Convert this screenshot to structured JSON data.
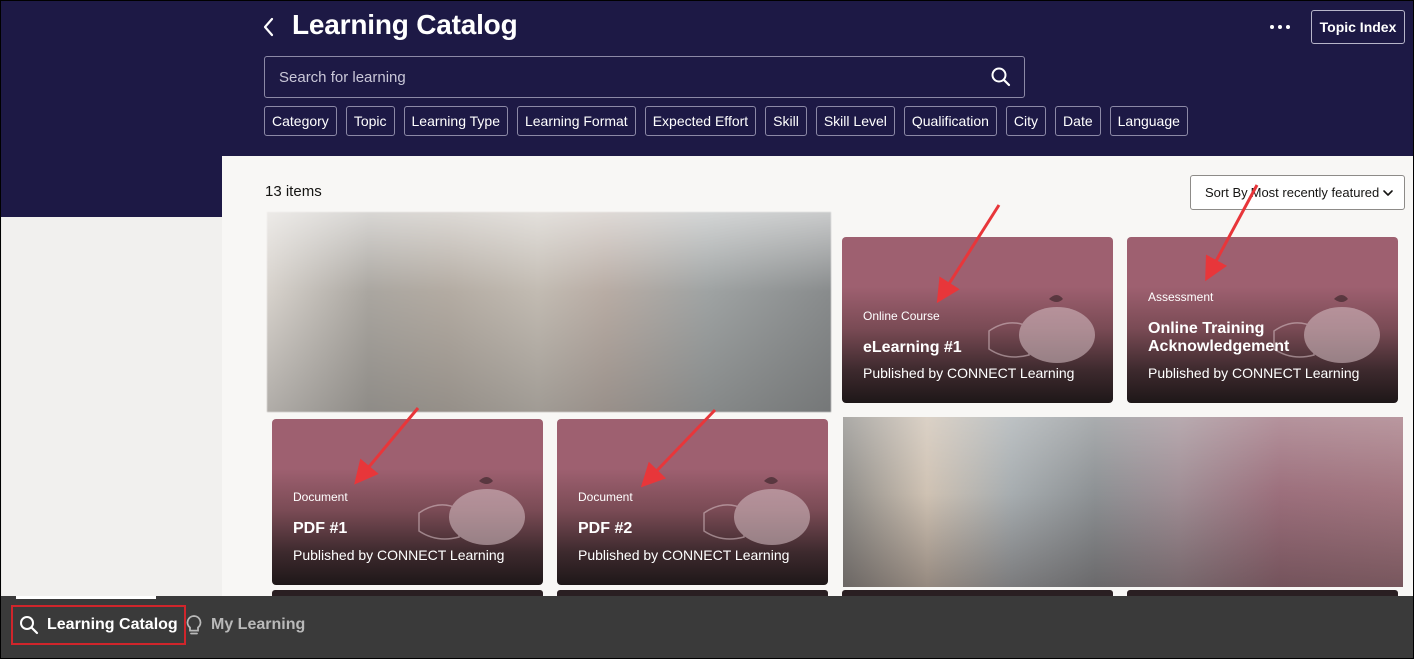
{
  "header": {
    "title": "Learning Catalog",
    "topic_index_label": "Topic Index"
  },
  "search": {
    "placeholder": "Search for learning"
  },
  "filters": [
    "Category",
    "Topic",
    "Learning Type",
    "Learning Format",
    "Expected Effort",
    "Skill",
    "Skill Level",
    "Qualification",
    "City",
    "Date",
    "Language"
  ],
  "results": {
    "count_label": "13 items",
    "sort_label": "Sort By",
    "sort_value": "Most recently featured"
  },
  "cards": [
    {
      "type": "Online Course",
      "title": "eLearning #1",
      "publisher": "Published by CONNECT Learning"
    },
    {
      "type": "Assessment",
      "title": "Online Training Acknowledgement",
      "publisher": "Published by CONNECT Learning"
    },
    {
      "type": "Document",
      "title": "PDF #1",
      "publisher": "Published by CONNECT Learning"
    },
    {
      "type": "Document",
      "title": "PDF #2",
      "publisher": "Published by CONNECT Learning"
    }
  ],
  "bottom_nav": {
    "items": [
      {
        "label": "Learning Catalog",
        "icon": "search-icon",
        "active": true
      },
      {
        "label": "My Learning",
        "icon": "lightbulb-icon",
        "active": false
      }
    ]
  },
  "colors": {
    "header_bg": "#1d1945",
    "card_accent": "#9e6070",
    "annotation": "#e8363a",
    "bottom_bar": "#3a3a3a"
  }
}
